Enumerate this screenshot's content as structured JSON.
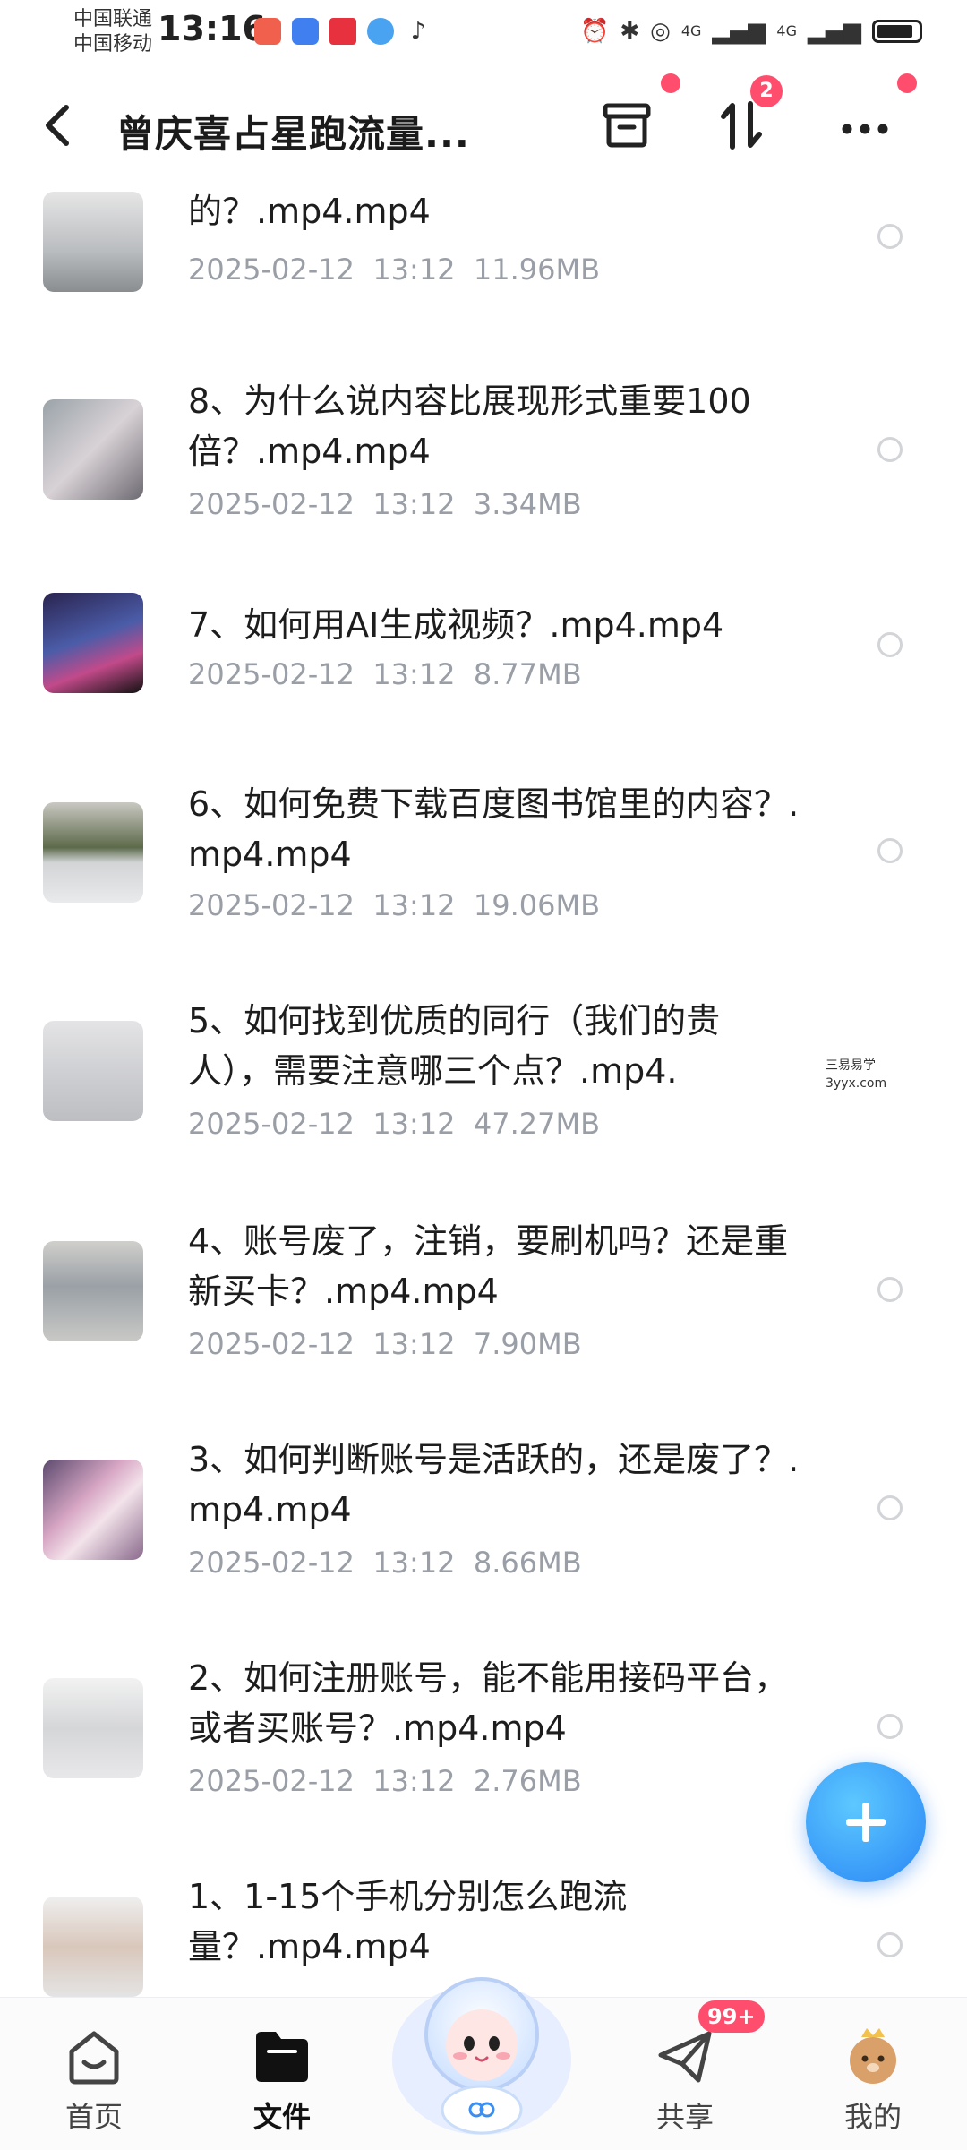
{
  "status_bar": {
    "carrier_1": "中国联通",
    "carrier_2": "中国移动",
    "time": "13:16",
    "network_1": "4G",
    "network_2": "4G"
  },
  "header": {
    "title": "曾庆喜占星跑流量...",
    "sort_badge_count": "2"
  },
  "files": [
    {
      "name": "的？.mp4.mp4",
      "date": "2025-02-12",
      "time": "13:12",
      "size": "11.96MB"
    },
    {
      "name": "8、为什么说内容比展现形式重要100倍？.mp4.mp4",
      "date": "2025-02-12",
      "time": "13:12",
      "size": "3.34MB"
    },
    {
      "name": "7、如何用AI生成视频？.mp4.mp4",
      "date": "2025-02-12",
      "time": "13:12",
      "size": "8.77MB"
    },
    {
      "name": "6、如何免费下载百度图书馆里的内容？.mp4.mp4",
      "date": "2025-02-12",
      "time": "13:12",
      "size": "19.06MB"
    },
    {
      "name": "5、如何找到优质的同行（我们的贵人），需要注意哪三个点？.mp4.",
      "date": "2025-02-12",
      "time": "13:12",
      "size": "47.27MB"
    },
    {
      "name": "4、账号废了，注销，要刷机吗？还是重新买卡？.mp4.mp4",
      "date": "2025-02-12",
      "time": "13:12",
      "size": "7.90MB"
    },
    {
      "name": "3、如何判断账号是活跃的，还是废了？.mp4.mp4",
      "date": "2025-02-12",
      "time": "13:12",
      "size": "8.66MB"
    },
    {
      "name": "2、如何注册账号，能不能用接码平台，或者买账号？.mp4.mp4",
      "date": "2025-02-12",
      "time": "13:12",
      "size": "2.76MB"
    },
    {
      "name": "1、1-15个手机分别怎么跑流量？.mp4.mp4",
      "date": "",
      "time": "",
      "size": ""
    }
  ],
  "watermark": {
    "line1": "三易易学",
    "line2": "3yyx.com"
  },
  "bottom_nav": {
    "home": "首页",
    "files": "文件",
    "share": "共享",
    "share_badge": "99+",
    "mine": "我的"
  },
  "colors": {
    "accent": "#2a86f5",
    "badge": "#ff4d6d",
    "meta_text": "#9a9ea6"
  }
}
